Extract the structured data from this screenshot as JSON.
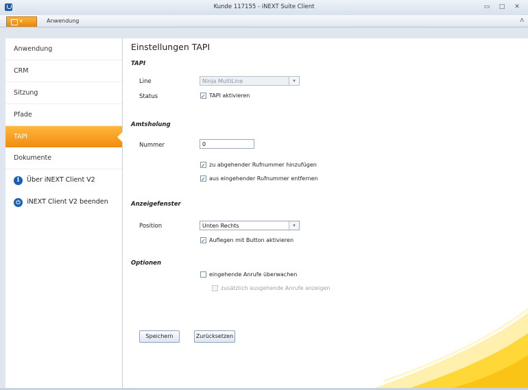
{
  "window": {
    "title": "Kunde 117155 - iNEXT Suite Client",
    "minimize_glyph": "▭",
    "maximize_glyph": "□",
    "close_glyph": "✕"
  },
  "ribbon": {
    "app_menu_arrow": "▾",
    "tab_label": "Anwendung",
    "collapse_glyph": "ᐱ"
  },
  "sidebar": {
    "items": [
      {
        "label": "Anwendung"
      },
      {
        "label": "CRM"
      },
      {
        "label": "Sitzung"
      },
      {
        "label": "Pfade"
      },
      {
        "label": "TAPI"
      },
      {
        "label": "Dokumente"
      }
    ],
    "actions": [
      {
        "label": "Über iNEXT Client V2",
        "icon": "info-icon",
        "glyph": "i"
      },
      {
        "label": "iNEXT Client V2 beenden",
        "icon": "power-icon",
        "glyph": "⏻"
      }
    ]
  },
  "main": {
    "heading": "Einstellungen TAPI",
    "tapi": {
      "section": "TAPI",
      "line_label": "Line",
      "line_value": "Ninja MultiLine",
      "status_label": "Status",
      "tapi_activate": "TAPI aktivieren"
    },
    "amtsholung": {
      "section": "Amtsholung",
      "number_label": "Nummer",
      "number_value": "0",
      "add_outgoing": "zu abgehender Rufnummer hinzufügen",
      "remove_incoming": "aus eingehender Rufnummer entfernen"
    },
    "anzeige": {
      "section": "Anzeigefenster",
      "position_label": "Position",
      "position_value": "Unten Rechts",
      "hangup_button": "Auflegen mit Button aktivieren"
    },
    "optionen": {
      "section": "Optionen",
      "monitor_incoming": "eingehende Anrufe überwachen",
      "show_outgoing": "zusätzlich ausgehende Anrufe anzeigen"
    },
    "buttons": {
      "save": "Speichern",
      "reset": "Zurücksetzen"
    },
    "check_glyph": "✓",
    "dropdown_glyph": "▾"
  },
  "colors": {
    "accent_orange": "#f5a023",
    "brand_blue": "#1a5eb5",
    "swoosh_yellow": "#ffd21a"
  }
}
